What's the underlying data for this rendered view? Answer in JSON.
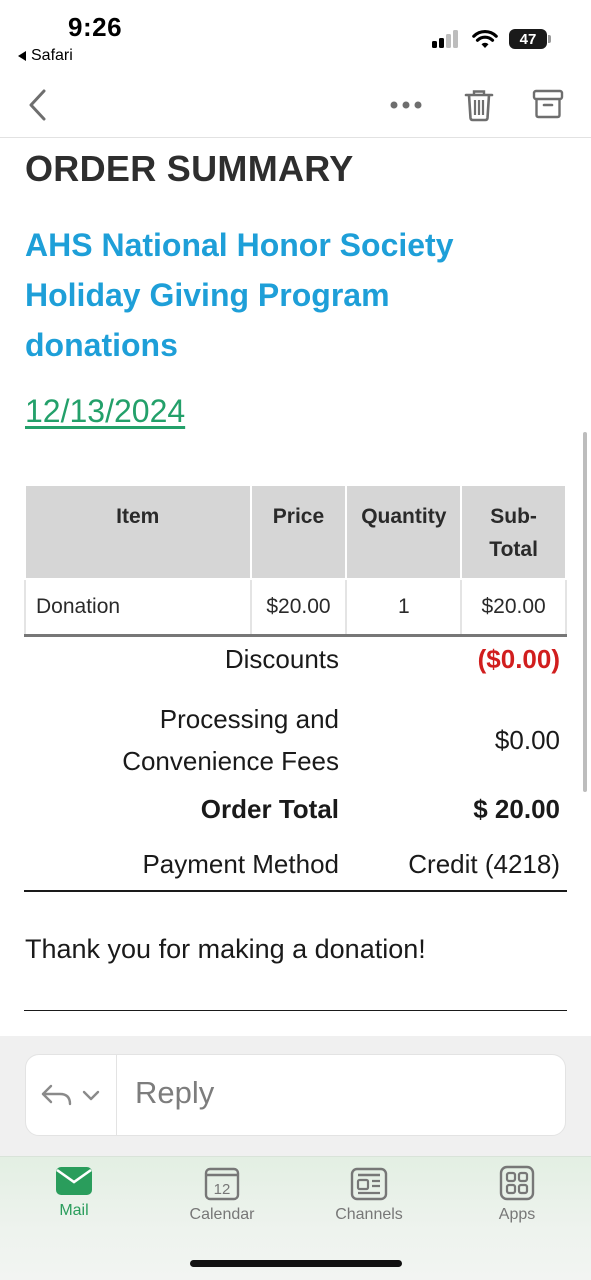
{
  "status_bar": {
    "time": "9:26",
    "back_app": "Safari",
    "battery": "47"
  },
  "toolbar": {
    "back_icon": "chevron-left-icon",
    "more_icon": "ellipsis-icon",
    "trash_icon": "trash-icon",
    "archive_icon": "archive-box-icon"
  },
  "email": {
    "title": "ORDER SUMMARY",
    "organization": "AHS National Honor Society Holiday Giving Program donations",
    "date": "12/13/2024",
    "table": {
      "headers": {
        "item": "Item",
        "price": "Price",
        "quantity": "Quantity",
        "subtotal_line1": "Sub-",
        "subtotal_line2": "Total"
      },
      "rows": [
        {
          "item": "Donation",
          "price": "$20.00",
          "quantity": "1",
          "subtotal": "$20.00"
        }
      ]
    },
    "summary": {
      "discounts_label": "Discounts",
      "discounts_value": "($0.00)",
      "fees_label_line1": "Processing and",
      "fees_label_line2": "Convenience Fees",
      "fees_value": "$0.00",
      "total_label": "Order Total",
      "total_value": "$ 20.00",
      "payment_label": "Payment Method",
      "payment_value": "Credit (4218)"
    },
    "thank_you": "Thank you for making a donation!"
  },
  "reply": {
    "placeholder": "Reply",
    "icon": "reply-arrow-icon"
  },
  "tabbar": {
    "tabs": [
      {
        "label": "Mail",
        "icon": "mail-envelope-icon",
        "active": true
      },
      {
        "label": "Calendar",
        "icon": "calendar-icon",
        "calendar_day": "12",
        "active": false
      },
      {
        "label": "Channels",
        "icon": "newspaper-icon",
        "active": false
      },
      {
        "label": "Apps",
        "icon": "apps-grid-icon",
        "active": false
      }
    ]
  },
  "colors": {
    "heading_blue": "#1e9fd8",
    "date_green": "#23a06a",
    "discount_red": "#d11e1e",
    "tab_active_green": "#2a9d5c"
  }
}
